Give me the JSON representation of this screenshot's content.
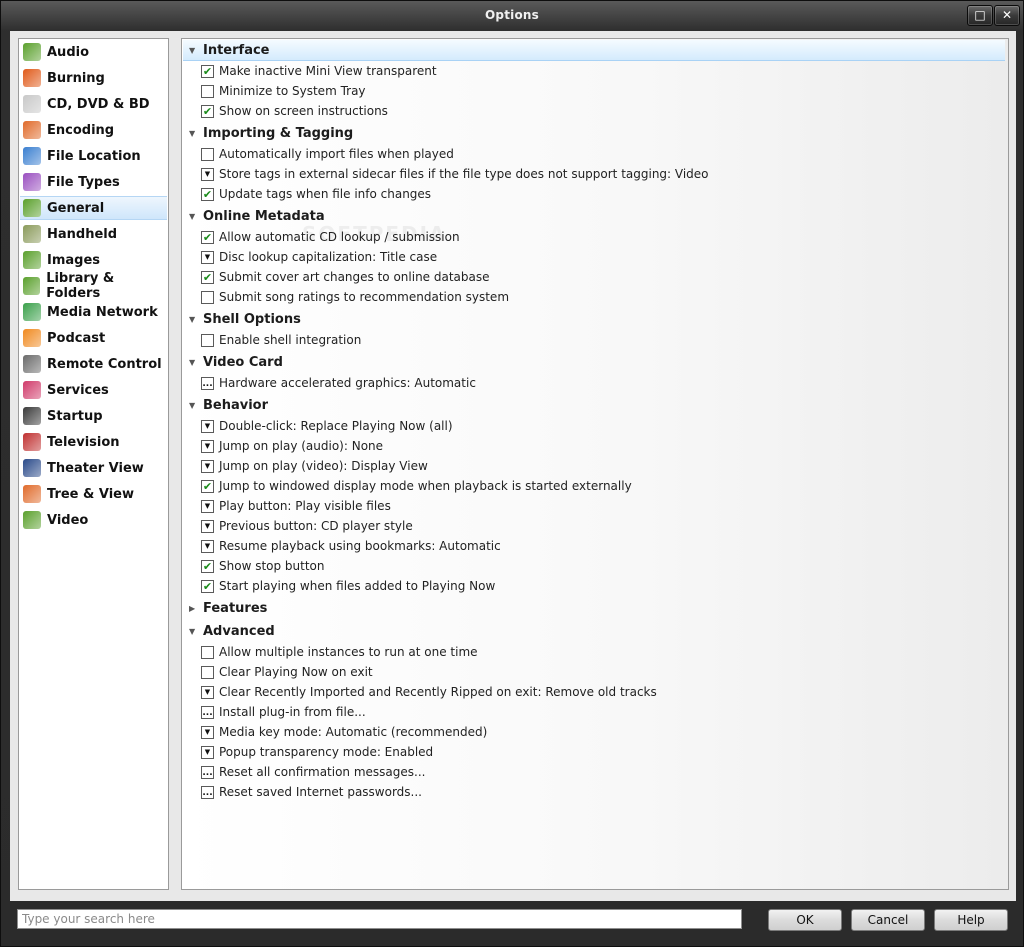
{
  "window": {
    "title": "Options"
  },
  "titlebar": {
    "maximize_glyph": "□",
    "close_glyph": "✕"
  },
  "sidebar": {
    "items": [
      {
        "label": "Audio",
        "icon": "audio-icon",
        "color": "#5aa02c"
      },
      {
        "label": "Burning",
        "icon": "burning-icon",
        "color": "#e05a1a"
      },
      {
        "label": "CD, DVD & BD",
        "icon": "disc-icon",
        "color": "#c8c8c8"
      },
      {
        "label": "Encoding",
        "icon": "encoding-icon",
        "color": "#e06a2a"
      },
      {
        "label": "File Location",
        "icon": "globe-icon",
        "color": "#3a7fd0"
      },
      {
        "label": "File Types",
        "icon": "puzzle-icon",
        "color": "#9a4fc0"
      },
      {
        "label": "General",
        "icon": "general-icon",
        "color": "#5aa02c"
      },
      {
        "label": "Handheld",
        "icon": "handheld-icon",
        "color": "#8a9a5a"
      },
      {
        "label": "Images",
        "icon": "images-icon",
        "color": "#5aa02c"
      },
      {
        "label": "Library & Folders",
        "icon": "library-icon",
        "color": "#5aa02c"
      },
      {
        "label": "Media Network",
        "icon": "network-icon",
        "color": "#3aa04a"
      },
      {
        "label": "Podcast",
        "icon": "podcast-icon",
        "color": "#f08a20"
      },
      {
        "label": "Remote Control",
        "icon": "remote-icon",
        "color": "#6a6a6a"
      },
      {
        "label": "Services",
        "icon": "services-icon",
        "color": "#d03a6a"
      },
      {
        "label": "Startup",
        "icon": "startup-icon",
        "color": "#3a3a3a"
      },
      {
        "label": "Television",
        "icon": "television-icon",
        "color": "#c03030"
      },
      {
        "label": "Theater View",
        "icon": "theater-icon",
        "color": "#2a4a8a"
      },
      {
        "label": "Tree & View",
        "icon": "tree-icon",
        "color": "#e06a2a"
      },
      {
        "label": "Video",
        "icon": "video-icon",
        "color": "#5aa02c"
      }
    ],
    "selected": "General"
  },
  "sections": [
    {
      "title": "Interface",
      "rows": [
        {
          "type": "check",
          "checked": true,
          "label": "Make inactive Mini View transparent"
        },
        {
          "type": "check",
          "checked": false,
          "label": "Minimize to System Tray"
        },
        {
          "type": "check",
          "checked": true,
          "label": "Show on screen instructions"
        }
      ]
    },
    {
      "title": "Importing & Tagging",
      "rows": [
        {
          "type": "check",
          "checked": false,
          "label": "Automatically import files when played"
        },
        {
          "type": "dropdown",
          "label": "Store tags in external sidecar files if the file type does not support tagging: Video"
        },
        {
          "type": "check",
          "checked": true,
          "label": "Update tags when file info changes"
        }
      ]
    },
    {
      "title": "Online Metadata",
      "rows": [
        {
          "type": "check",
          "checked": true,
          "label": "Allow automatic CD lookup / submission"
        },
        {
          "type": "dropdown",
          "label": "Disc lookup capitalization: Title case"
        },
        {
          "type": "check",
          "checked": true,
          "label": "Submit cover art changes to online database"
        },
        {
          "type": "check",
          "checked": false,
          "label": "Submit song ratings to recommendation system"
        }
      ]
    },
    {
      "title": "Shell Options",
      "rows": [
        {
          "type": "check",
          "checked": false,
          "label": "Enable shell integration"
        }
      ]
    },
    {
      "title": "Video Card",
      "rows": [
        {
          "type": "ellipsis",
          "label": "Hardware accelerated graphics: Automatic"
        }
      ]
    },
    {
      "title": "Behavior",
      "rows": [
        {
          "type": "dropdown",
          "label": "Double-click: Replace Playing Now (all)"
        },
        {
          "type": "dropdown",
          "label": "Jump on play (audio): None"
        },
        {
          "type": "dropdown",
          "label": "Jump on play (video): Display View"
        },
        {
          "type": "check",
          "checked": true,
          "label": "Jump to windowed display mode when playback is started externally"
        },
        {
          "type": "dropdown",
          "label": "Play button: Play visible files"
        },
        {
          "type": "dropdown",
          "label": "Previous button: CD player style"
        },
        {
          "type": "dropdown",
          "label": "Resume playback using bookmarks: Automatic"
        },
        {
          "type": "check",
          "checked": true,
          "label": "Show stop button"
        },
        {
          "type": "check",
          "checked": true,
          "label": "Start playing when files added to Playing Now"
        }
      ]
    },
    {
      "title": "Features",
      "collapsed": true,
      "rows": []
    },
    {
      "title": "Advanced",
      "rows": [
        {
          "type": "check",
          "checked": false,
          "label": "Allow multiple instances to run at one time"
        },
        {
          "type": "check",
          "checked": false,
          "label": "Clear Playing Now on exit"
        },
        {
          "type": "dropdown",
          "label": "Clear Recently Imported and Recently Ripped on exit: Remove old tracks"
        },
        {
          "type": "ellipsis",
          "label": "Install plug-in from file..."
        },
        {
          "type": "dropdown",
          "label": "Media key mode: Automatic (recommended)"
        },
        {
          "type": "dropdown",
          "label": "Popup transparency mode: Enabled"
        },
        {
          "type": "ellipsis",
          "label": "Reset all confirmation messages..."
        },
        {
          "type": "ellipsis",
          "label": "Reset saved Internet passwords..."
        }
      ]
    }
  ],
  "search": {
    "placeholder": "Type your search here",
    "value": ""
  },
  "buttons": {
    "ok": "OK",
    "cancel": "Cancel",
    "help": "Help"
  }
}
